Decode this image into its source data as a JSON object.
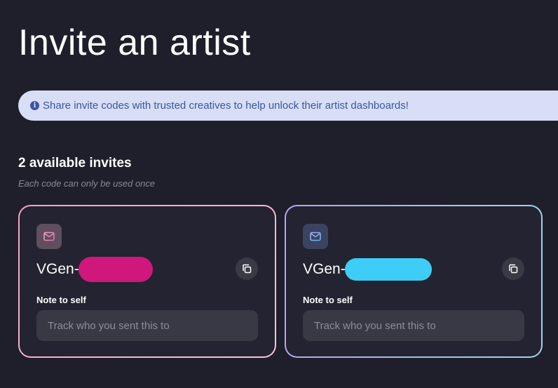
{
  "page": {
    "title": "Invite an artist"
  },
  "banner": {
    "icon": "info-icon",
    "text": "Share invite codes with trusted creatives to help unlock their artist dashboards!",
    "background": "#d8def5",
    "color": "#3b55a8"
  },
  "invites": {
    "heading": "2 available invites",
    "subtitle": "Each code can only be used once",
    "cards": [
      {
        "icon": "mail-icon",
        "code_prefix": "VGen-",
        "code_redaction_color": "#d0177b",
        "copy_icon": "copy-icon",
        "note_label": "Note to self",
        "note_placeholder": "Track who you sent this to",
        "note_value": "",
        "border_color": "#f5a3c7"
      },
      {
        "icon": "mail-icon",
        "code_prefix": "VGen-",
        "code_redaction_color": "#3dcdf7",
        "copy_icon": "copy-icon",
        "note_label": "Note to self",
        "note_placeholder": "Track who you sent this to",
        "note_value": "",
        "border_color": "#b5a7ee"
      }
    ]
  }
}
